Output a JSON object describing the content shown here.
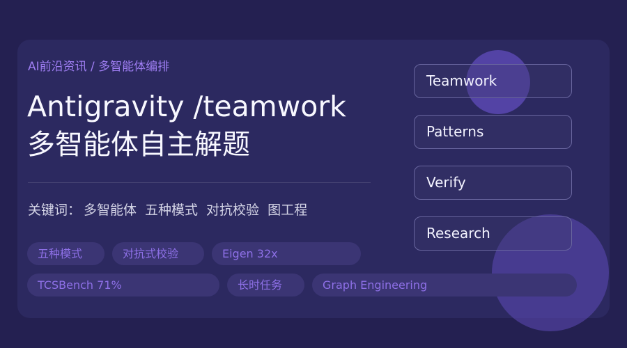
{
  "breadcrumb": "AI前沿资讯 / 多智能体编排",
  "title": "Antigravity /teamwork",
  "subtitle": "多智能体自主解题",
  "keywords": {
    "label": "关键词：",
    "items": [
      "多智能体",
      "五种模式",
      "对抗校验",
      "图工程"
    ]
  },
  "tags": [
    "五种模式",
    "对抗式校验",
    "Eigen 32x",
    "TCSBench 71%",
    "长时任务",
    "Graph Engineering"
  ],
  "nav": [
    "Teamwork",
    "Patterns",
    "Verify",
    "Research"
  ],
  "colors": {
    "page_background": "#242051",
    "card_background": "#2c2960",
    "accent": "#9f7ef3",
    "tag_background": "#3b3574",
    "button_border": "#69669f",
    "orb": "#5f4ab8"
  }
}
